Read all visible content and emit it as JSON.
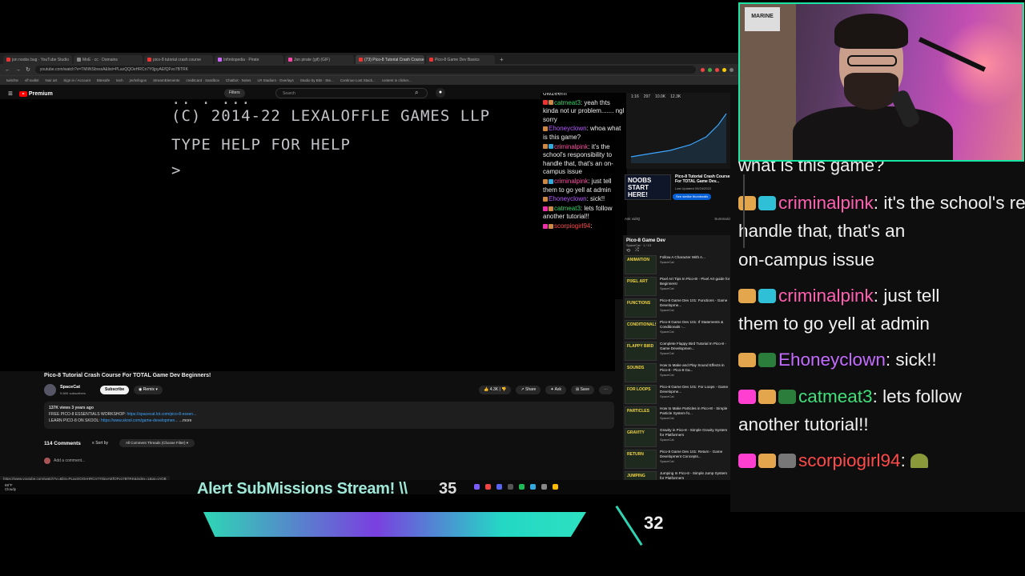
{
  "browser": {
    "tabs": [
      {
        "label": "jon noobs bug · YouTube Studio"
      },
      {
        "label": "MoE · cc · Domains"
      },
      {
        "label": "pico-8 tutorial crash course"
      },
      {
        "label": "Infinitopedia · Pirate"
      },
      {
        "label": "Jon pirate (gif) (GIF)"
      },
      {
        "label": "(73) Pico-8 Tutorial Crash Course"
      },
      {
        "label": "Pico-8 Game Dev Basics"
      }
    ],
    "url": "youtube.com/watch?v=TMIiNSbvsxA&list=PLaxQQOeHRCn7Y0jpyAEfQFvo7BTRK",
    "bookmarks": [
      "twitchtv",
      "vfl toolkit",
      "Noir art",
      "Sign in / Account",
      "Bitesafe",
      "tech",
      "jm/tv/logos",
      "StreamElements",
      "creditcard · Sandbox",
      "Chatbot · Notes",
      "LR Stadium · Overlays",
      "Studio by Bits · Ste...",
      "Continue Lost Stack...",
      "content in clicker..."
    ],
    "statusbar_url": "https://www.youtube.com/watch?v=&list=PLaxQQOeHRCn7Y0jpyAEfQFvo7BTRK&index=1&pp=iAQB"
  },
  "youtube": {
    "logo": "Premium",
    "filters": "Filters",
    "search_placeholder": "Search",
    "video_title": "Pico-8 Tutorial Crash Course For TOTAL Game Dev Beginners!",
    "channel": "SpaceCat",
    "subs": "9.66K subscribers",
    "subscribe": "Subscribe",
    "remix": "Remix",
    "actions": {
      "likes": "4.3K",
      "share": "Share",
      "ask": "Ask",
      "save": "Save"
    },
    "desc": {
      "meta": "137K views  3 years ago",
      "line1_prefix": "FREE PICO-8 ESSENTIALS WORKSHOP: ",
      "line1_link": "https://spacecat.lot.com/pico-8-essen...",
      "line2_prefix": "LEARN PICO-8 ON SKOOL: ",
      "line2_link": "https://www.skool.com/game-developmen...",
      "more": "...more"
    },
    "comments_count": "114 Comments",
    "sort_by": "Sort by",
    "thread_filter": "All Comment Threads (Choose Filter)",
    "add_comment": "Add a comment..."
  },
  "pico8": {
    "line_partial": "(C) 2014-22 LEXALOFFLE GAMES LLP",
    "line_help": "TYPE HELP FOR HELP",
    "prompt": ">"
  },
  "mini_chat": [
    {
      "name": "catmeat3",
      "color": "#39d26a",
      "text": "yeah thts kinda not ur problem....... ngl sorry"
    },
    {
      "name": "Ehoneyclown",
      "color": "#b65bff",
      "text": "whoa what is this game?"
    },
    {
      "name": "criminalpink",
      "color": "#ff4fa3",
      "text": "it's the school's responsibility to handle that, that's an on-campus issue"
    },
    {
      "name": "criminalpink",
      "color": "#ff4fa3",
      "text": "just tell them to go yell at admin"
    },
    {
      "name": "Ehoneyclown",
      "color": "#b65bff",
      "text": "sick!!"
    },
    {
      "name": "catmeat3",
      "color": "#39d26a",
      "text": "lets follow another tutorial!!"
    },
    {
      "name": "scorpiogirl94",
      "color": "#ff4a4a",
      "text": ""
    }
  ],
  "mini_chat_header": "owzeem",
  "stats": {
    "a": "1:16",
    "b": "297",
    "c": "10.0K",
    "d": "12.3K"
  },
  "studio_card": {
    "thumb_text": "NOOBS START HERE!",
    "title": "Pico-8 Tutorial Crash Course For TOTAL Game Dev...",
    "date": "Last Updated 09/24/2022",
    "button": "See similar thumbnails"
  },
  "summary_row": {
    "left": "Ask vidIQ",
    "right": "Summarize"
  },
  "playlist": {
    "title": "Pico-8 Game Dev",
    "sub": "SpaceCat · 1 / 13",
    "items": [
      {
        "thumb": "ANIMATION",
        "title": "Follow A Character With A...",
        "chan": "SpaceCat"
      },
      {
        "thumb": "PIXEL ART",
        "title": "Pixel Art Tips In Pico-8! - Pixel Art guide for Beginners!",
        "chan": "SpaceCat"
      },
      {
        "thumb": "FUNCTIONS",
        "title": "Pico-8 Game Dev 101: Functions - Game Developme...",
        "chan": "SpaceCat"
      },
      {
        "thumb": "CONDITIONALS",
        "title": "Pico-8 Game Dev 101: If Statements & Conditionals -...",
        "chan": "SpaceCat"
      },
      {
        "thumb": "FLAPPY BIRD",
        "title": "Complete Flappy Bird Tutorial In Pico-8 - Game Developmen...",
        "chan": "SpaceCat"
      },
      {
        "thumb": "SOUNDS",
        "title": "How to Make and Play Sound Effects in Pico-8 - Pico-8 Ga...",
        "chan": "SpaceCat"
      },
      {
        "thumb": "FOR LOOPS",
        "title": "Pico-8 Game Dev 101: For Loops - Game Developme...",
        "chan": "SpaceCat"
      },
      {
        "thumb": "PARTICLES",
        "title": "How to Make Particles in Pico-8! - Simple Particle System fo...",
        "chan": "SpaceCat"
      },
      {
        "thumb": "GRAVITY",
        "title": "Gravity in Pico-8 - Simple Gravity System for Platformers",
        "chan": "SpaceCat"
      },
      {
        "thumb": "RETURN",
        "title": "Pico-8 Game Dev 101: Return - Game Development Concepts...",
        "chan": "SpaceCat"
      },
      {
        "thumb": "JUMPING",
        "title": "Jumping In Pico-8 - Simple Jump System for Platformers",
        "chan": "SpaceCat"
      }
    ]
  },
  "taskbar": {
    "weather_temp": "69°F",
    "weather_desc": "Cloudy"
  },
  "stream": {
    "alert_title": "Alert SubMissions Stream! \\\\",
    "alert_count": "35",
    "goal_count": "32",
    "webcam_poster": "MARINE"
  },
  "big_chat": {
    "cut_line": "what is this game?",
    "lines": [
      {
        "name": "criminalpink",
        "color": "#ff5fb0",
        "text": " it's the school's responsibility to"
      },
      {
        "name": "",
        "color": "",
        "text": "handle that, that's an"
      },
      {
        "name": "",
        "color": "",
        "text": "on-campus issue"
      },
      {
        "name": "criminalpink",
        "color": "#ff5fb0",
        "text": " just tell"
      },
      {
        "name": "",
        "color": "",
        "text": "them to go yell at admin"
      },
      {
        "name": "Ehoneyclown",
        "color": "#c46bff",
        "text": " sick!!"
      },
      {
        "name": "catmeat3",
        "color": "#3fe07a",
        "text": " lets follow"
      },
      {
        "name": "",
        "color": "",
        "text": "another tutorial!!"
      },
      {
        "name": "scorpiogirl94",
        "color": "#ff4a4a",
        "text": ""
      }
    ]
  }
}
